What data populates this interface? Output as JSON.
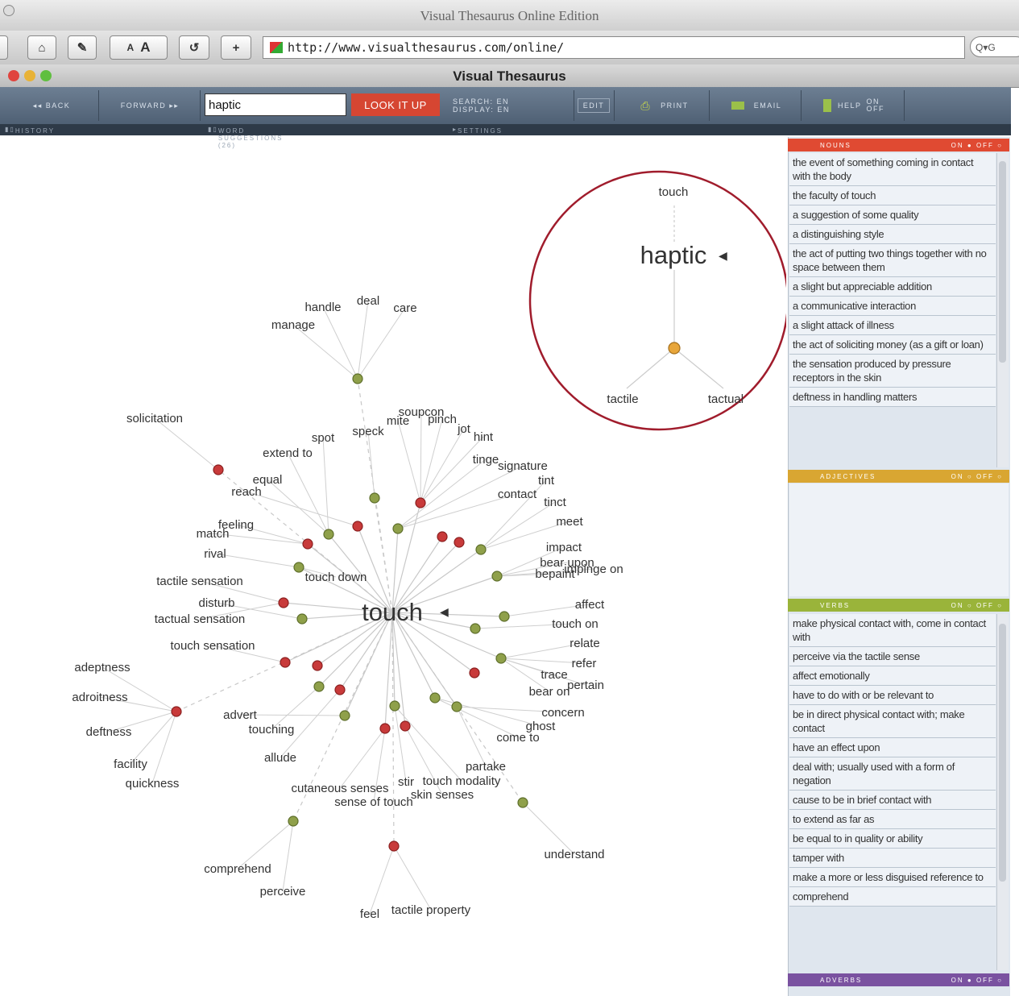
{
  "window": {
    "title": "Visual Thesaurus Online Edition"
  },
  "browser": {
    "url": "http://www.visualthesaurus.com/online/",
    "search_placeholder": "Q▾G"
  },
  "app": {
    "title": "Visual Thesaurus",
    "back_label": "◂◂ BACK",
    "forward_label": "FORWARD ▸▸",
    "search_value": "haptic",
    "lookup_label": "LOOK IT UP",
    "search_lang": "SEARCH: EN",
    "display_lang": "DISPLAY: EN",
    "edit_label": "EDIT",
    "print_label": "PRINT",
    "email_label": "EMAIL",
    "help_label": "HELP",
    "help_on": "ON",
    "help_off": "OFF",
    "history_label": "HISTORY",
    "suggestions_label": "WORD SUGGESTIONS (26)",
    "settings_label": "SETTINGS"
  },
  "panels": {
    "nouns": {
      "label": "NOUNS",
      "on": "ON",
      "off": "OFF",
      "color": "#e04a32",
      "items": [
        "the event of something coming in contact with the body",
        "the faculty of touch",
        "a suggestion of some quality",
        "a distinguishing style",
        "the act of putting two things together with no space between them",
        "a slight but appreciable addition",
        "a communicative interaction",
        "a slight attack of illness",
        "the act of soliciting money (as a gift or loan)",
        "the sensation produced by pressure receptors in the skin",
        "deftness in handling matters"
      ]
    },
    "adjectives": {
      "label": "ADJECTIVES",
      "on": "ON",
      "off": "OFF",
      "color": "#d9a632"
    },
    "verbs": {
      "label": "VERBS",
      "on": "ON",
      "off": "OFF",
      "color": "#9ab43a",
      "items": [
        "make physical contact with, come in contact with",
        "perceive via the tactile sense",
        "affect emotionally",
        "have to do with or be relevant to",
        "be in direct physical contact with; make contact",
        "have an effect upon",
        "deal with; usually used with a form of negation",
        "cause to be in brief contact with",
        "to extend as far as",
        "be equal to in quality or ability",
        "tamper with",
        "make a more or less disguised reference to",
        "comprehend"
      ]
    },
    "adverbs": {
      "label": "ADVERBS",
      "on": "ON",
      "off": "OFF",
      "color": "#7a52a0"
    }
  },
  "graph": {
    "center_word": "touch",
    "inset": {
      "center_word": "haptic",
      "top": "touch",
      "left": "tactile",
      "right": "tactual"
    },
    "labels": {
      "handle": "handle",
      "deal": "deal",
      "care": "care",
      "manage": "manage",
      "solicitation": "solicitation",
      "spot": "spot",
      "speck": "speck",
      "mite": "mite",
      "soupcon": "soupcon",
      "pinch": "pinch",
      "jot": "jot",
      "hint": "hint",
      "extend_to": "extend to",
      "tinge": "tinge",
      "signature": "signature",
      "tint": "tint",
      "contact": "contact",
      "tinct": "tinct",
      "equal": "equal",
      "reach": "reach",
      "meet": "meet",
      "feeling": "feeling",
      "match": "match",
      "rival": "rival",
      "impact": "impact",
      "bear_upon": "bear upon",
      "bepaint": "bepaint",
      "impinge_on": "impinge on",
      "touch_down": "touch down",
      "tactile_sensation": "tactile sensation",
      "disturb": "disturb",
      "tactual_sensation": "tactual sensation",
      "affect": "affect",
      "touch_on": "touch on",
      "relate": "relate",
      "touch_sensation": "touch sensation",
      "refer": "refer",
      "trace": "trace",
      "pertain": "pertain",
      "bear_on": "bear on",
      "adeptness": "adeptness",
      "adroitness": "adroitness",
      "concern": "concern",
      "advert": "advert",
      "ghost": "ghost",
      "come_to": "come to",
      "deftness": "deftness",
      "touching": "touching",
      "allude": "allude",
      "facility": "facility",
      "quickness": "quickness",
      "partake": "partake",
      "stir": "stir",
      "touch_modality": "touch modality",
      "cutaneous_senses": "cutaneous senses",
      "skin_senses": "skin senses",
      "sense_of_touch": "sense of touch",
      "comprehend": "comprehend",
      "understand": "understand",
      "perceive": "perceive",
      "feel": "feel",
      "tactile_property": "tactile property"
    }
  }
}
